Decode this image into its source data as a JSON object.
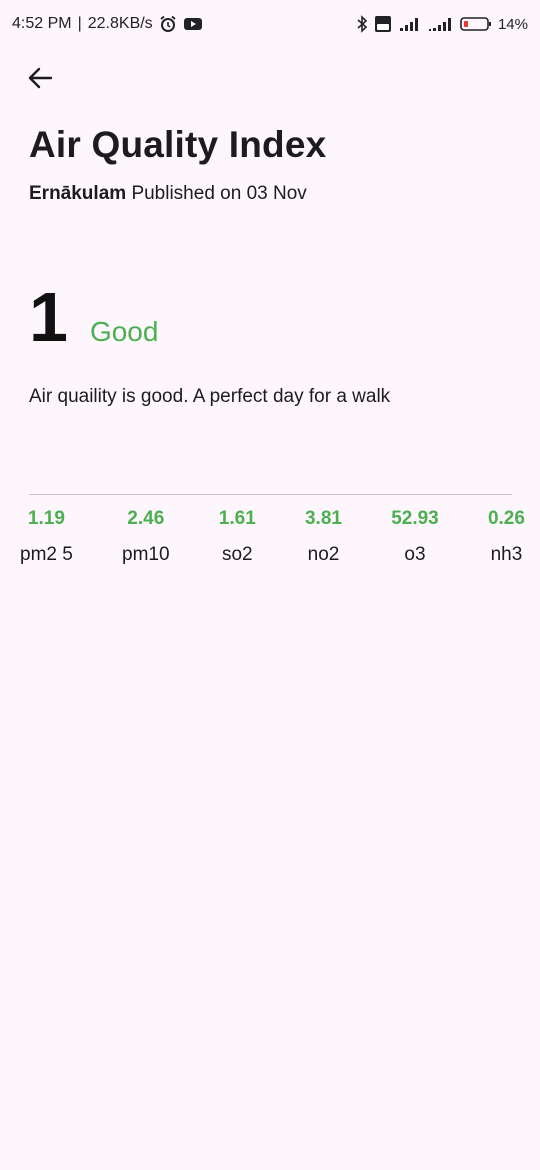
{
  "status_bar": {
    "time": "4:52 PM",
    "separator": "|",
    "net_speed": "22.8KB/s",
    "battery_pct": "14%",
    "battery_color": "#e53935",
    "icons": [
      "alarm-icon",
      "youtube-icon",
      "bluetooth-icon",
      "volte-icon",
      "signal-icon",
      "signal-icon",
      "battery-icon"
    ]
  },
  "header": {
    "title": "Air Quality Index",
    "location": "Ernākulam",
    "published": "Published on 03 Nov"
  },
  "aqi": {
    "value": "1",
    "level": "Good",
    "description": "Air quaility is good. A perfect day for a walk",
    "level_color": "#4caf50"
  },
  "pollutants": [
    {
      "value": "1.19",
      "name": "pm2 5"
    },
    {
      "value": "2.46",
      "name": "pm10"
    },
    {
      "value": "1.61",
      "name": "so2"
    },
    {
      "value": "3.81",
      "name": "no2"
    },
    {
      "value": "52.93",
      "name": "o3"
    },
    {
      "value": "0.26",
      "name": "nh3"
    }
  ]
}
